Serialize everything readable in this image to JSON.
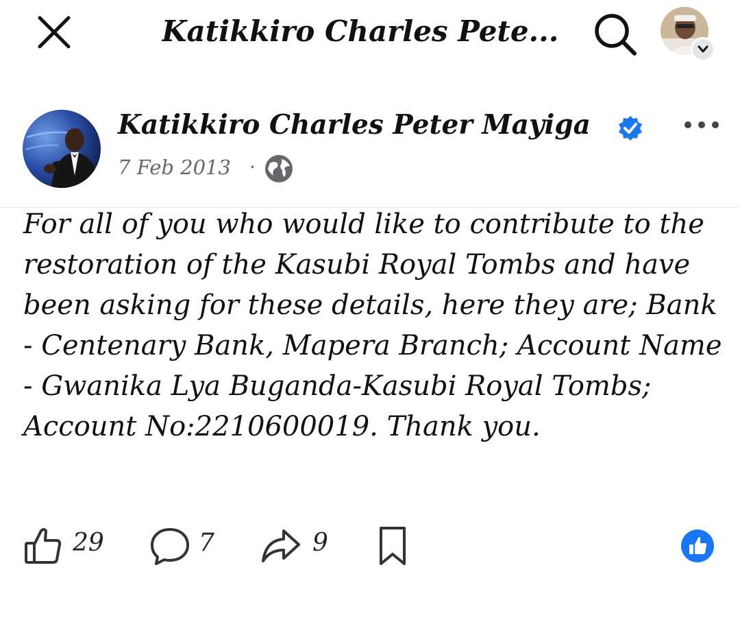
{
  "topbar": {
    "title": "Katikkiro Charles Pete...",
    "close_icon": "close-icon",
    "search_icon": "search-icon",
    "profile_icon": "avatar"
  },
  "post": {
    "author": "Katikkiro Charles Peter Mayiga",
    "verified": true,
    "date": "7 Feb 2013",
    "separator": "·",
    "privacy_icon": "globe-icon",
    "text": "For all of you who would like to contribute to the restoration of the Kasubi Royal Tombs and have been asking for these details, here they are; Bank - Centenary Bank, Mapera Branch; Account Name - Gwanika Lya Buganda-Kasubi Royal Tombs; Account No:2210600019. Thank you."
  },
  "actions": {
    "like_count": "29",
    "comment_count": "7",
    "share_count": "9"
  },
  "colors": {
    "accent": "#1877f2",
    "muted": "#65676b",
    "text": "#111111"
  }
}
